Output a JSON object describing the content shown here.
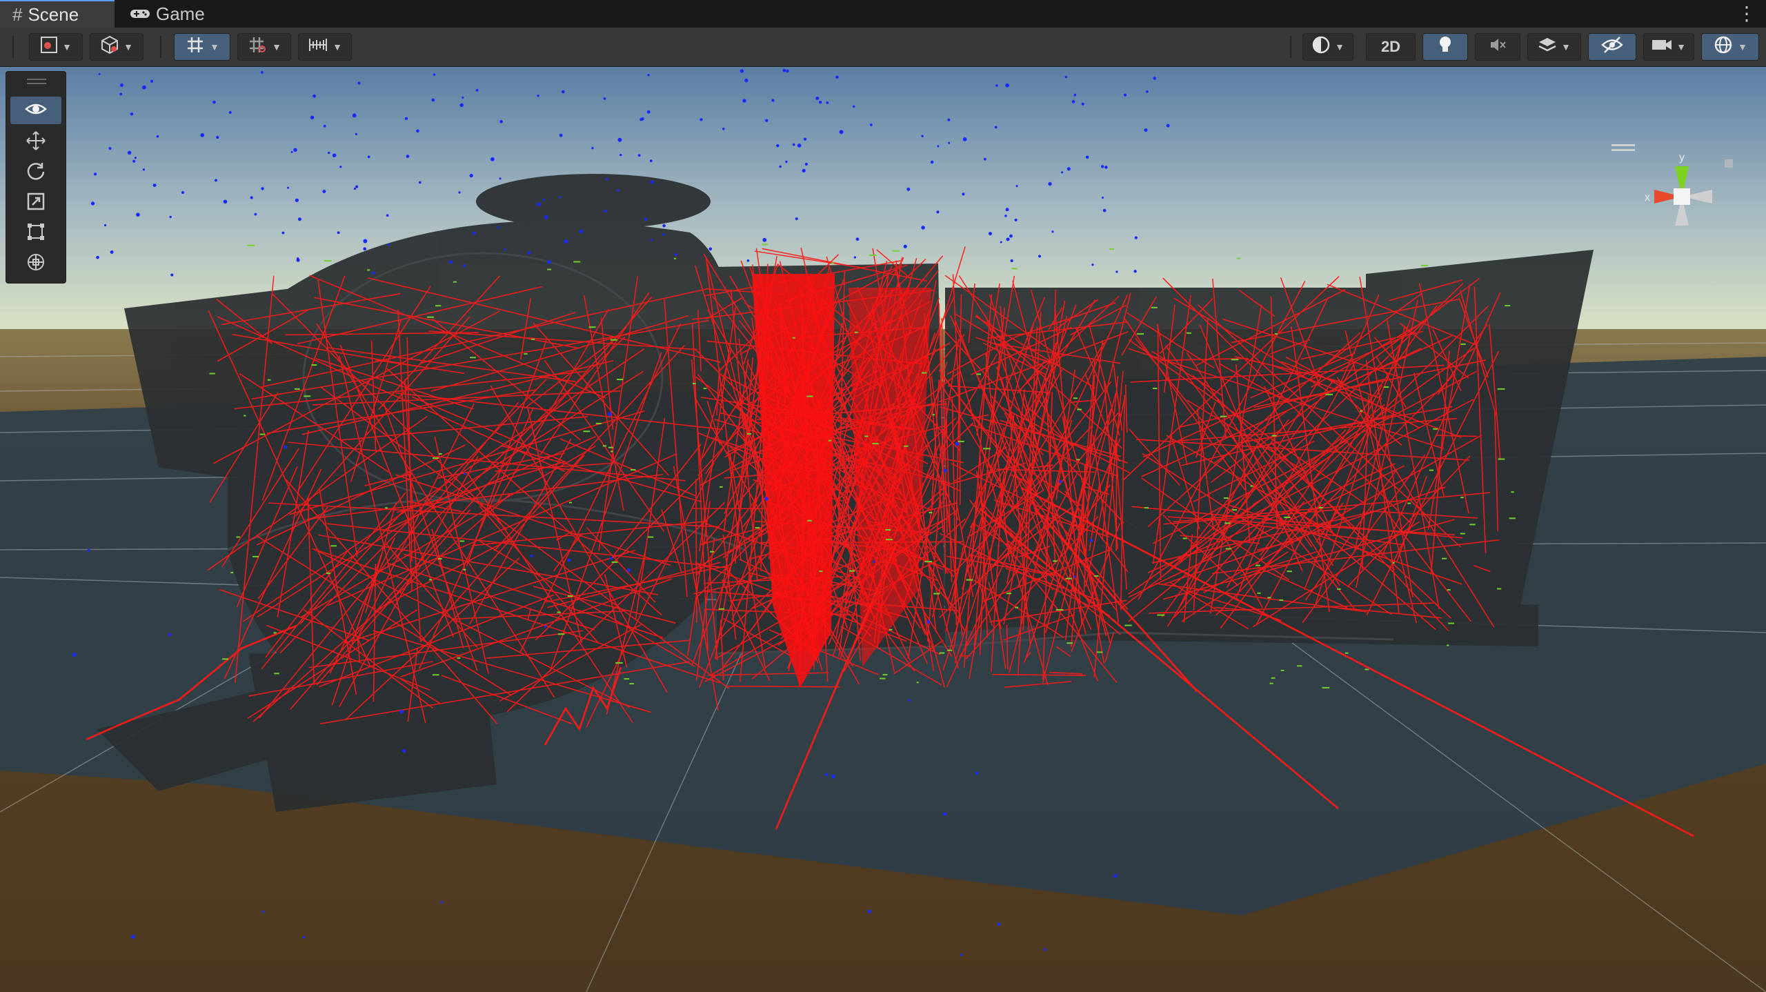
{
  "tabs": [
    {
      "label": "Scene",
      "icon": "hash-grid-icon",
      "active": true
    },
    {
      "label": "Game",
      "icon": "gamepad-icon",
      "active": false
    }
  ],
  "menu_icon": "kebab-menu-icon",
  "toolbar": {
    "left": [
      {
        "name": "draw-mode-button",
        "icon": "shaded-draw-mode-icon"
      },
      {
        "name": "render-mode-button",
        "icon": "cube-icon"
      },
      {
        "name": "grid-snapping-button",
        "icon": "grid-snap-icon",
        "active": true
      },
      {
        "name": "incremental-snap-button",
        "icon": "increment-snap-icon"
      },
      {
        "name": "vertex-snap-button",
        "icon": "ruler-icon"
      }
    ],
    "right": [
      {
        "name": "shading-mode-button",
        "icon": "sphere-shading-icon"
      },
      {
        "name": "2d-toggle",
        "label": "2D"
      },
      {
        "name": "lighting-toggle",
        "icon": "lightbulb-icon",
        "active": true
      },
      {
        "name": "audio-toggle",
        "icon": "mute-icon"
      },
      {
        "name": "effects-button",
        "icon": "layers-effects-icon"
      },
      {
        "name": "visibility-toggle",
        "icon": "hidden-eye-icon",
        "active": true
      },
      {
        "name": "camera-button",
        "icon": "camera-icon"
      },
      {
        "name": "gizmos-button",
        "icon": "gizmo-globe-icon",
        "active": true
      }
    ]
  },
  "tools": [
    {
      "name": "view-tool",
      "icon": "eye-icon",
      "active": true
    },
    {
      "name": "move-tool",
      "icon": "move-arrows-icon"
    },
    {
      "name": "rotate-tool",
      "icon": "rotate-icon"
    },
    {
      "name": "scale-tool",
      "icon": "scale-icon"
    },
    {
      "name": "rect-tool",
      "icon": "rect-transform-icon"
    },
    {
      "name": "transform-tool",
      "icon": "transform-icon"
    }
  ],
  "orientation_gizmo": {
    "y_label": "y",
    "x_label": "x",
    "y_color": "#7ed321",
    "x_color": "#e8492a",
    "z_color": "#d8d8d8"
  },
  "colors": {
    "sky_top": "#5d7fa3",
    "sky_horizon": "#d6e0c0",
    "ground": "#4e3a1f",
    "floor": "#2f3e4a",
    "rays": "#ff1a1a",
    "points_blue": "#1a2cff",
    "points_green": "#6fd12a"
  }
}
